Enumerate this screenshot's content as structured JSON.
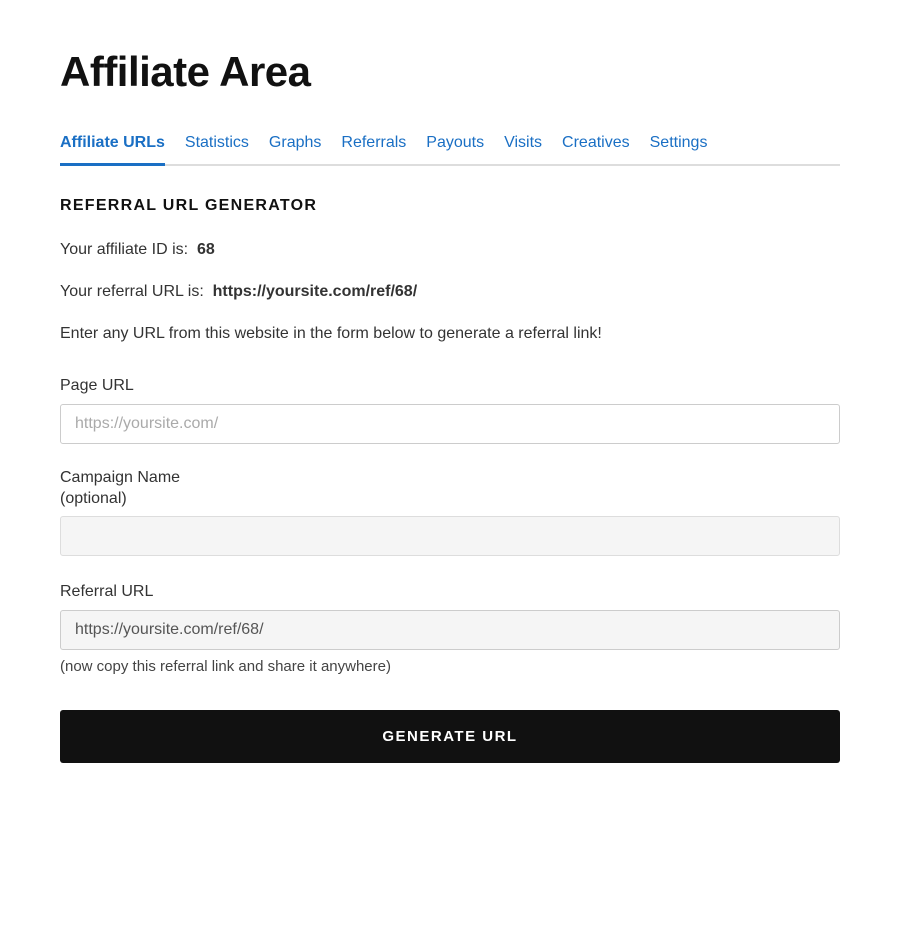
{
  "page": {
    "title": "Affiliate Area"
  },
  "nav": {
    "tabs": [
      {
        "label": "Affiliate URLs",
        "active": true
      },
      {
        "label": "Statistics",
        "active": false
      },
      {
        "label": "Graphs",
        "active": false
      },
      {
        "label": "Referrals",
        "active": false
      },
      {
        "label": "Payouts",
        "active": false
      },
      {
        "label": "Visits",
        "active": false
      },
      {
        "label": "Creatives",
        "active": false
      },
      {
        "label": "Settings",
        "active": false
      }
    ]
  },
  "section": {
    "title": "REFERRAL URL GENERATOR",
    "affiliate_id_label": "Your affiliate ID is:",
    "affiliate_id_value": "68",
    "referral_url_label": "Your referral URL is:",
    "referral_url_value": "https://yoursite.com/ref/68/",
    "description": "Enter any URL from this website in the form below to generate a referral link!",
    "page_url_label": "Page URL",
    "page_url_placeholder": "https://yoursite.com/",
    "campaign_label": "Campaign Name",
    "campaign_label_sub": "(optional)",
    "campaign_placeholder": "",
    "referral_url_field_label": "Referral URL",
    "referral_url_field_value": "https://yoursite.com/ref/68/",
    "helper_text": "(now copy this referral link and share it anywhere)",
    "generate_button_label": "GENERATE URL"
  }
}
